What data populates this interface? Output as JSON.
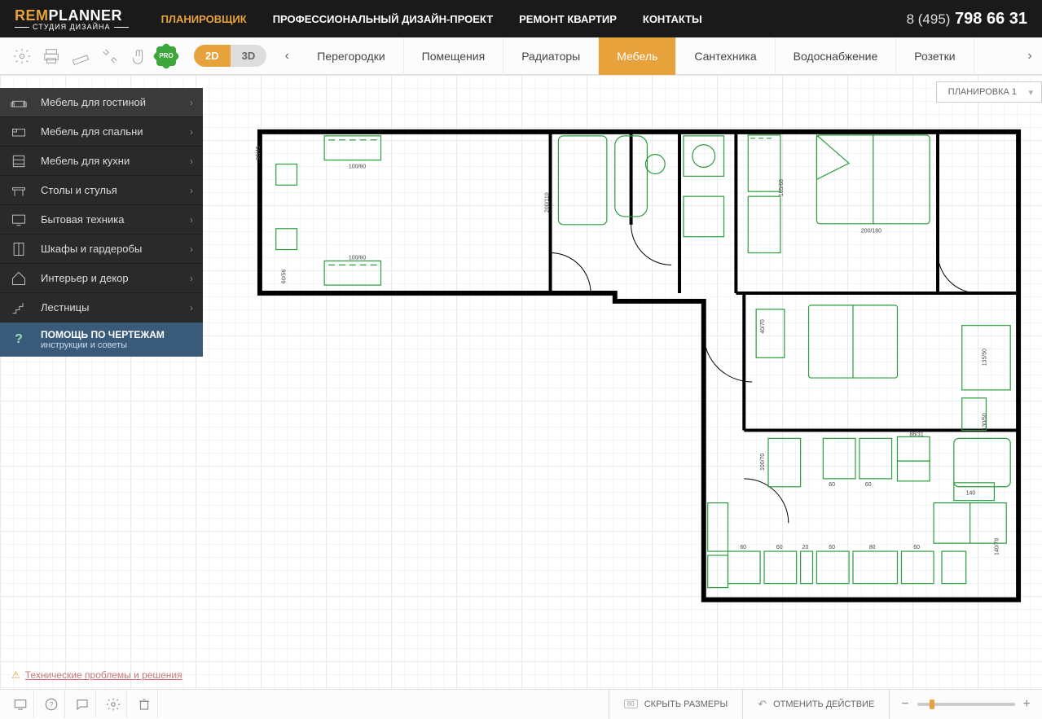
{
  "header": {
    "logo": {
      "rem": "REM",
      "planner": "PLANNER",
      "sub": "СТУДИЯ ДИЗАЙНА"
    },
    "nav": [
      {
        "label": "ПЛАНИРОВЩИК",
        "active": true
      },
      {
        "label": "ПРОФЕССИОНАЛЬНЫЙ ДИЗАЙН-ПРОЕКТ",
        "active": false
      },
      {
        "label": "РЕМОНТ КВАРТИР",
        "active": false
      },
      {
        "label": "КОНТАКТЫ",
        "active": false
      }
    ],
    "phone": {
      "prefix": "8 (495)",
      "number": "798 66 31"
    }
  },
  "toolbar": {
    "view2d": "2D",
    "view3d": "3D",
    "pro": "PRO",
    "tabs": [
      {
        "label": "Перегородки"
      },
      {
        "label": "Помещения"
      },
      {
        "label": "Радиаторы"
      },
      {
        "label": "Мебель",
        "active": true
      },
      {
        "label": "Сантехника"
      },
      {
        "label": "Водоснабжение"
      },
      {
        "label": "Розетки"
      }
    ]
  },
  "plan_dropdown": "ПЛАНИРОВКА 1",
  "sidebar": {
    "items": [
      {
        "label": "Мебель для гостиной",
        "active": true
      },
      {
        "label": "Мебель для спальни"
      },
      {
        "label": "Мебель для кухни"
      },
      {
        "label": "Столы и стулья"
      },
      {
        "label": "Бытовая техника"
      },
      {
        "label": "Шкафы и гардеробы"
      },
      {
        "label": "Интерьер и декор"
      },
      {
        "label": "Лестницы"
      }
    ],
    "help": {
      "title": "ПОМОЩЬ ПО ЧЕРТЕЖАМ",
      "sub": "инструкции и советы"
    }
  },
  "floorplan": {
    "dimensions_visible": [
      "90/45",
      "200/110",
      "100/60",
      "100/60",
      "60/56",
      "165/68",
      "200/180",
      "40/70",
      "100/70",
      "135/50",
      "130/50",
      "88/31",
      "60",
      "60",
      "140",
      "60",
      "20",
      "60",
      "80",
      "60",
      "140/78"
    ]
  },
  "tech_link": "Технические проблемы и решения",
  "bottom": {
    "hide_sizes": "СКРЫТЬ РАЗМЕРЫ",
    "hide_sizes_badge": "80",
    "undo": "ОТМЕНИТЬ ДЕЙСТВИЕ"
  }
}
